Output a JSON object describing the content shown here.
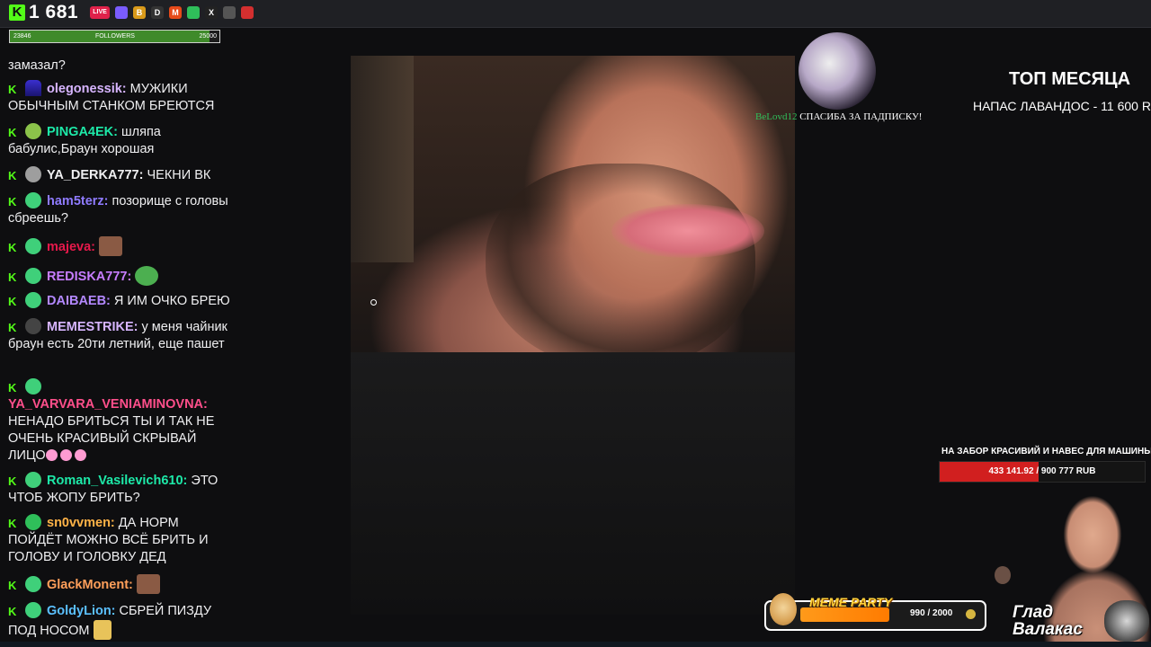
{
  "topbar": {
    "viewer_count": "1 681",
    "tab_icons": [
      {
        "name": "live-icon",
        "label": "LIVE",
        "color": "#e0214a"
      },
      {
        "name": "pinned-icon",
        "label": "",
        "color": "#7a5cff"
      },
      {
        "name": "b-icon",
        "label": "B",
        "color": "#d99a1a"
      },
      {
        "name": "d-icon",
        "label": "D",
        "color": "#333"
      },
      {
        "name": "m-icon",
        "label": "M",
        "color": "#e64a19"
      },
      {
        "name": "circle-icon",
        "label": "",
        "color": "#2fbf5a"
      },
      {
        "name": "x-icon",
        "label": "X",
        "color": "#222"
      },
      {
        "name": "grid-icon",
        "label": "",
        "color": "#555"
      },
      {
        "name": "red-icon",
        "label": "",
        "color": "#d32f2f"
      }
    ]
  },
  "followers": {
    "label": "FOLLOWERS",
    "current": "23846",
    "goal": "25000",
    "progress": 0.954
  },
  "chat": [
    {
      "user": "",
      "color": "#efeff1",
      "text": "замазал?",
      "badge": "none"
    },
    {
      "user": "olegonessik:",
      "color": "#d7b5ff",
      "text": "МУЖИКИ ОБЫЧНЫМ СТАНКОМ БРЕЮТСЯ",
      "badge": "wizard"
    },
    {
      "user": "PINGA4EK:",
      "color": "#1de9a8",
      "text": "шляпа бабулис,Браун хорошая",
      "badge": "leaf"
    },
    {
      "user": "YA_DERKA777:",
      "color": "#efeff1",
      "text": "ЧЕКНИ ВК",
      "badge": "skull"
    },
    {
      "user": "ham5terz:",
      "color": "#8f7bff",
      "text": "позорище с головы сбреешь?",
      "badge": "heart"
    },
    {
      "user": "majeva:",
      "color": "#e6194b",
      "text": "",
      "badge": "heart",
      "emote": "face"
    },
    {
      "user": "REDISKA777:",
      "color": "#c77dff",
      "text": "",
      "badge": "heart",
      "emote": "frog"
    },
    {
      "user": "DAIBAEB:",
      "color": "#b388ff",
      "text": "Я ИМ ОЧКО БРЕЮ",
      "badge": "heart"
    },
    {
      "user": "MEMESTRIKE:",
      "color": "#d7b5ff",
      "text": "у меня чайник браун есть 20ти летний, еще пашет",
      "badge": "hat"
    },
    {
      "user": "YA_VARVARA_VENIAMINOVNA:",
      "color": "#ff4f8b",
      "text": "НЕНАДО БРИТЬСЯ ТЫ И ТАК НЕ ОЧЕНЬ КРАСИВЫЙ СКРЫВАЙ ЛИЦО",
      "badge": "heart"
    },
    {
      "user": "Roman_Vasilevich610:",
      "color": "#1de9a8",
      "text": "ЭТО ЧТОБ ЖОПУ БРИТЬ?",
      "badge": "heart"
    },
    {
      "user": "sn0vvmen:",
      "color": "#ffb347",
      "text": "ДА НОРМ ПОЙДЁТ МОЖНО ВСЁ БРИТЬ И ГОЛОВУ И ГОЛОВКУ ДЕД",
      "badge": "avatar"
    },
    {
      "user": "GlackMonent:",
      "color": "#ff9f5a",
      "text": "",
      "badge": "heart",
      "emote": "face"
    },
    {
      "user": "GoldyLion:",
      "color": "#5bc0ff",
      "text": "СБРЕЙ ПИЗДУ ПОД НОСОМ",
      "badge": "heart",
      "emote": "hands"
    }
  ],
  "subscription_alert": {
    "name": "BeLovd12",
    "text": "СПАСИБА ЗА ПАДПИСКУ!"
  },
  "top_month": {
    "title": "ТОП МЕСЯЦА",
    "entry": "НАПАС ЛАВАНДОС - 11 600 R"
  },
  "donation_goal": {
    "title": "НА ЗАБОР КРАСИВИЙ И НАВЕС ДЛЯ МАШИНЫ",
    "amount_text": "433 141.92 / 900 777 RUB",
    "progress": 0.481,
    "fill_color": "#d11f1f"
  },
  "meme_party": {
    "title": "MEME PARTY",
    "count_text": "990 / 2000",
    "progress": 0.495
  },
  "brand": {
    "line1": "Глад",
    "line2": "Валакас"
  }
}
